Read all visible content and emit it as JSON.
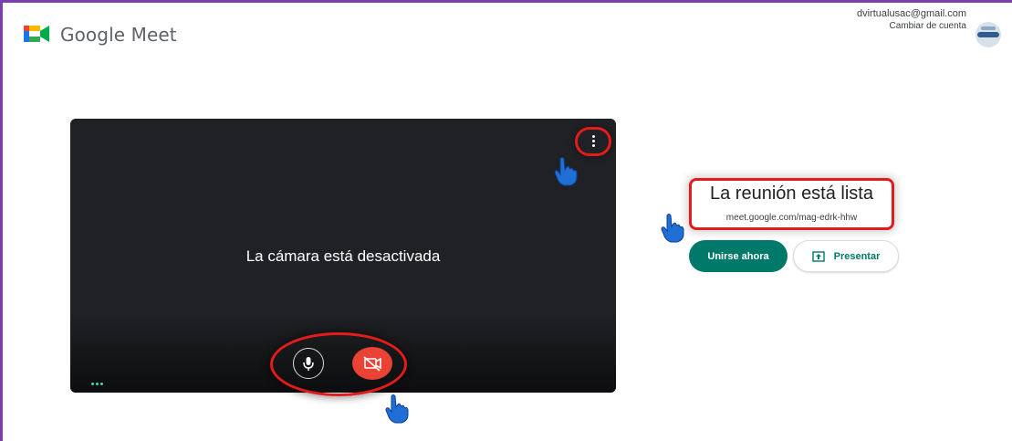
{
  "app": {
    "title": "Google Meet"
  },
  "account": {
    "email": "dvirtualusac@gmail.com",
    "switch_label": "Cambiar de cuenta"
  },
  "video": {
    "status_text": "La cámara está desactivada"
  },
  "meeting": {
    "ready_title": "La reunión está lista",
    "link": "meet.google.com/mag-edrk-hhw",
    "join_label": "Unirse ahora",
    "present_label": "Presentar"
  },
  "icons": [
    "meet-logo-icon",
    "more-vert-icon",
    "mic-icon",
    "camera-off-icon",
    "present-screen-icon",
    "pointing-hand-icon",
    "avatar-icon"
  ],
  "colors": {
    "accent": "#00796b",
    "camera_off": "#ea4335",
    "highlight": "#e21b1b",
    "frame": "#7b3fb0",
    "hand": "#1f6fd6"
  }
}
